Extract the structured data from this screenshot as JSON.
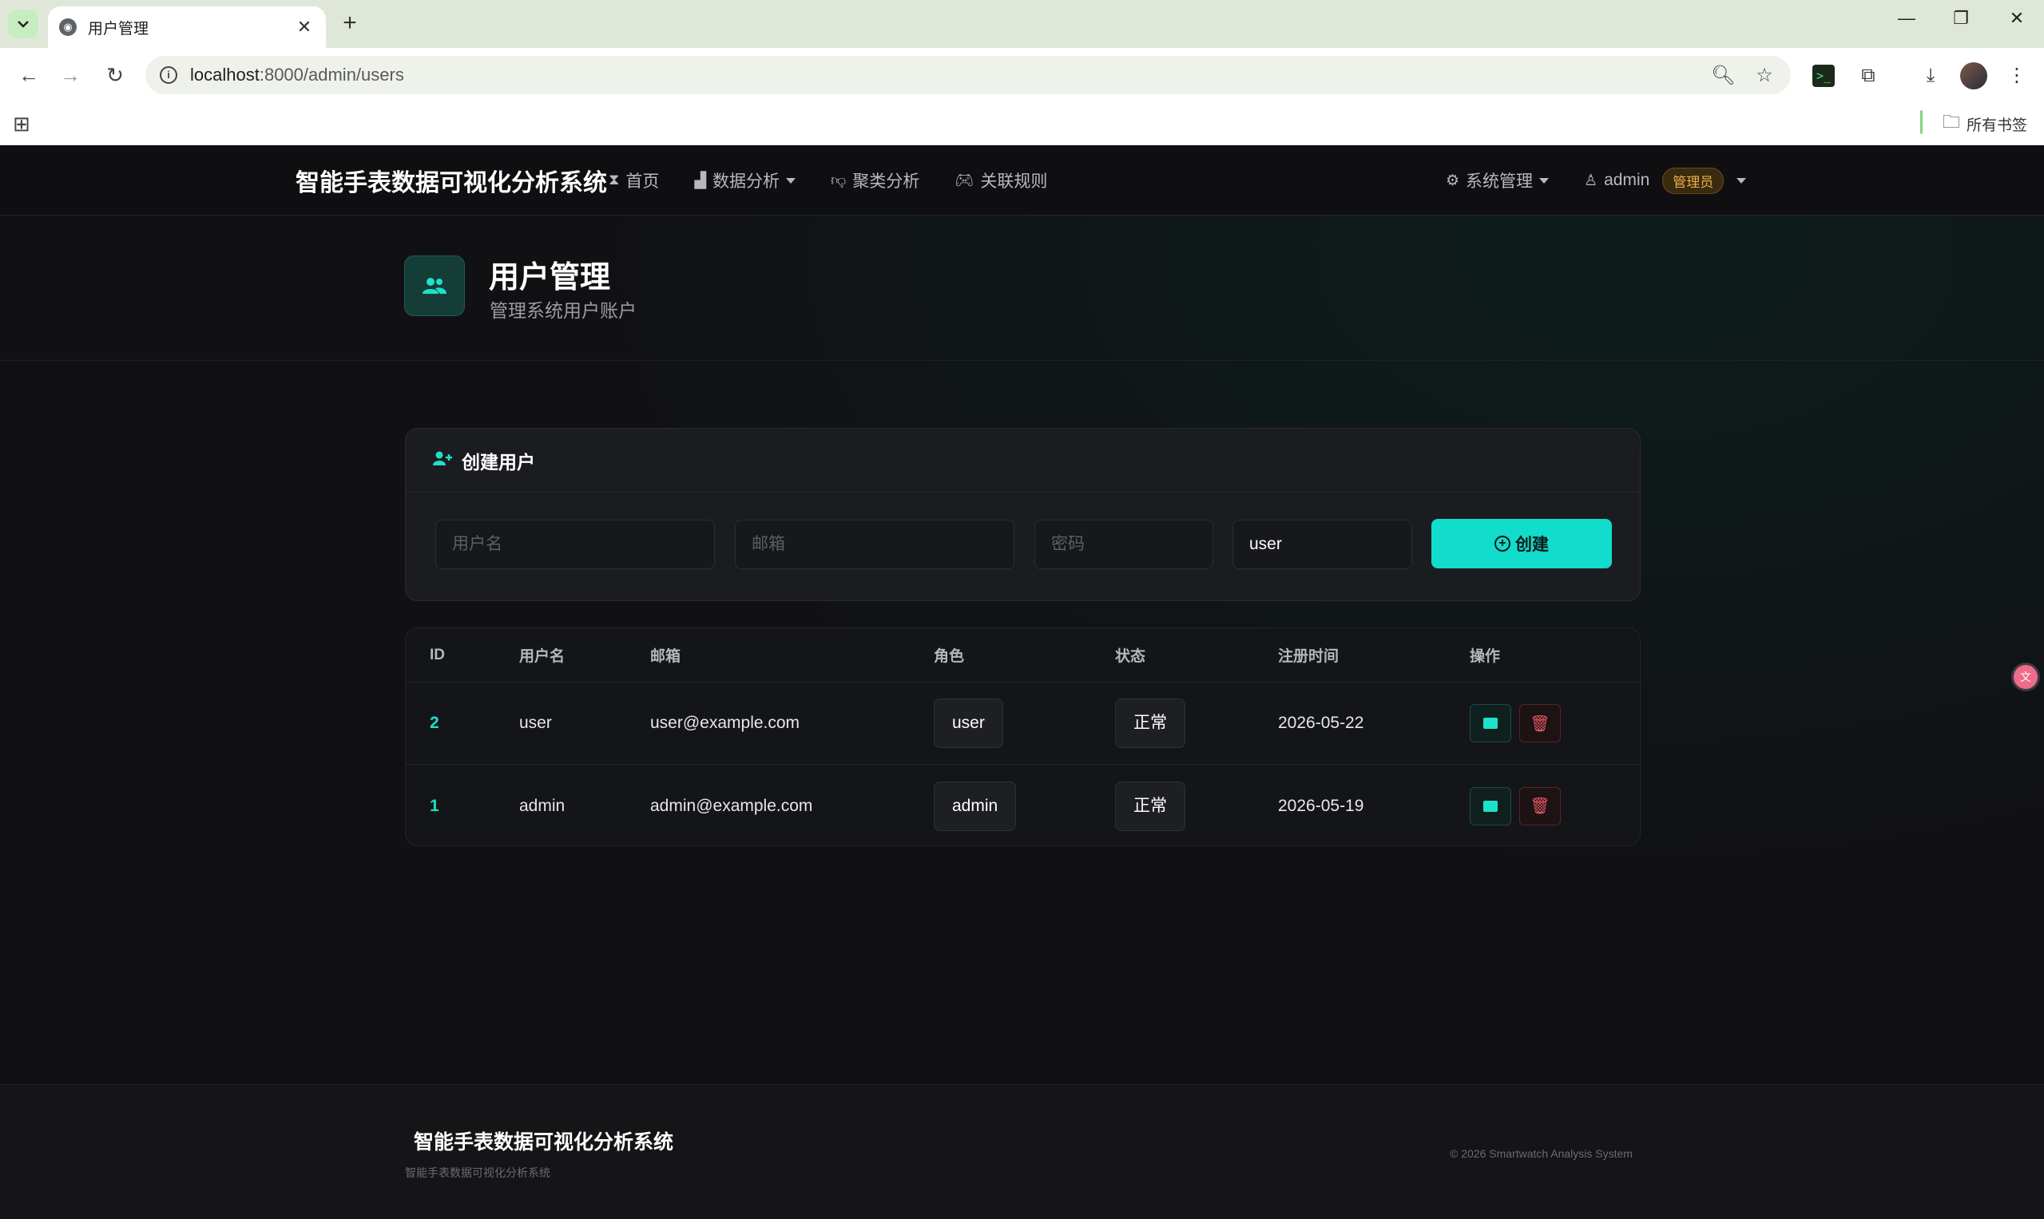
{
  "browser": {
    "tab_title": "用户管理",
    "url_host": "localhost",
    "url_path": ":8000/admin/users",
    "bookmarks_folder": "所有书签"
  },
  "nav": {
    "brand": "智能手表数据可视化分析系统",
    "links": [
      {
        "label": "首页",
        "icon": "hourglass-icon"
      },
      {
        "label": "数据分析",
        "icon": "bar-chart-icon"
      },
      {
        "label": "聚类分析",
        "icon": "thumbs-down-icon"
      },
      {
        "label": "关联规则",
        "icon": "gamepad-icon"
      }
    ],
    "system_menu": "系统管理",
    "user_name": "admin",
    "role_badge": "管理员"
  },
  "page": {
    "title": "用户管理",
    "subtitle": "管理系统用户账户"
  },
  "create_form": {
    "heading": "创建用户",
    "username_placeholder": "用户名",
    "email_placeholder": "邮箱",
    "password_placeholder": "密码",
    "role_value": "user",
    "submit_label": "创建"
  },
  "table": {
    "headers": [
      "ID",
      "用户名",
      "邮箱",
      "角色",
      "状态",
      "注册时间",
      "操作"
    ],
    "rows": [
      {
        "id": "2",
        "username": "user",
        "email": "user@example.com",
        "role": "user",
        "status": "正常",
        "registered": "2026-05-22"
      },
      {
        "id": "1",
        "username": "admin",
        "email": "admin@example.com",
        "role": "admin",
        "status": "正常",
        "registered": "2026-05-19"
      }
    ]
  },
  "footer": {
    "title": "智能手表数据可视化分析系统",
    "subtitle": "智能手表数据可视化分析系统",
    "copyright": "© 2026 Smartwatch Analysis System"
  },
  "colors": {
    "accent": "#12dccb",
    "background": "#111114",
    "danger": "#e05560",
    "badge": "#e8b04a"
  }
}
